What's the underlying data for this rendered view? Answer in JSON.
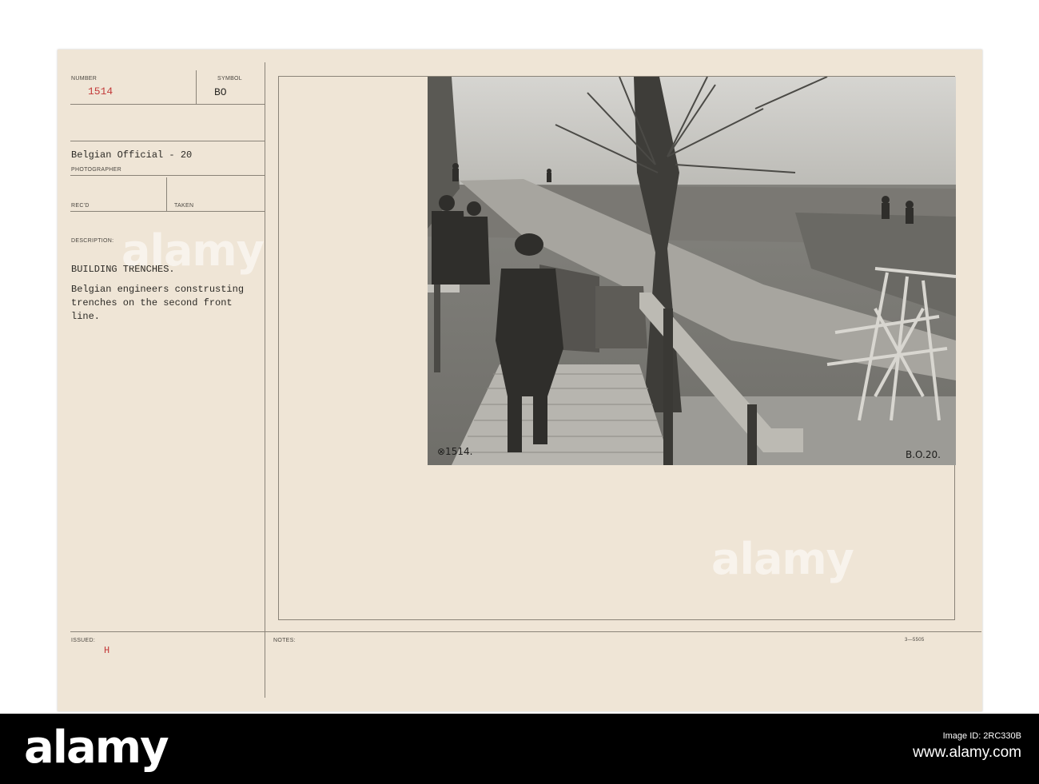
{
  "card": {
    "number_label": "NUMBER",
    "number": "1514",
    "symbol_label": "SYMBOL",
    "symbol": "BO",
    "photographer": "Belgian Official - 20",
    "photographer_label": "PHOTOGRAPHER",
    "recd_label": "REC'D",
    "taken_label": "TAKEN",
    "description_label": "DESCRIPTION:",
    "title": "BUILDING TRENCHES.",
    "description_lines": [
      "Belgian engineers construsting",
      "trenches on the second front",
      "line."
    ],
    "issued_label": "ISSUED:",
    "issued": "H",
    "notes_label": "NOTES:",
    "form_code": "3—5505"
  },
  "photo": {
    "inscription_left": "⊗1514.",
    "inscription_right": "B.O.20."
  },
  "watermark": {
    "text": "alamy"
  },
  "footer": {
    "logo": "alamy",
    "image_id_label": "Image ID: 2RC330B",
    "url": "www.alamy.com"
  },
  "colors": {
    "card": "#efe5d6",
    "stamp_red": "#c33a3a",
    "footer": "#000000"
  }
}
